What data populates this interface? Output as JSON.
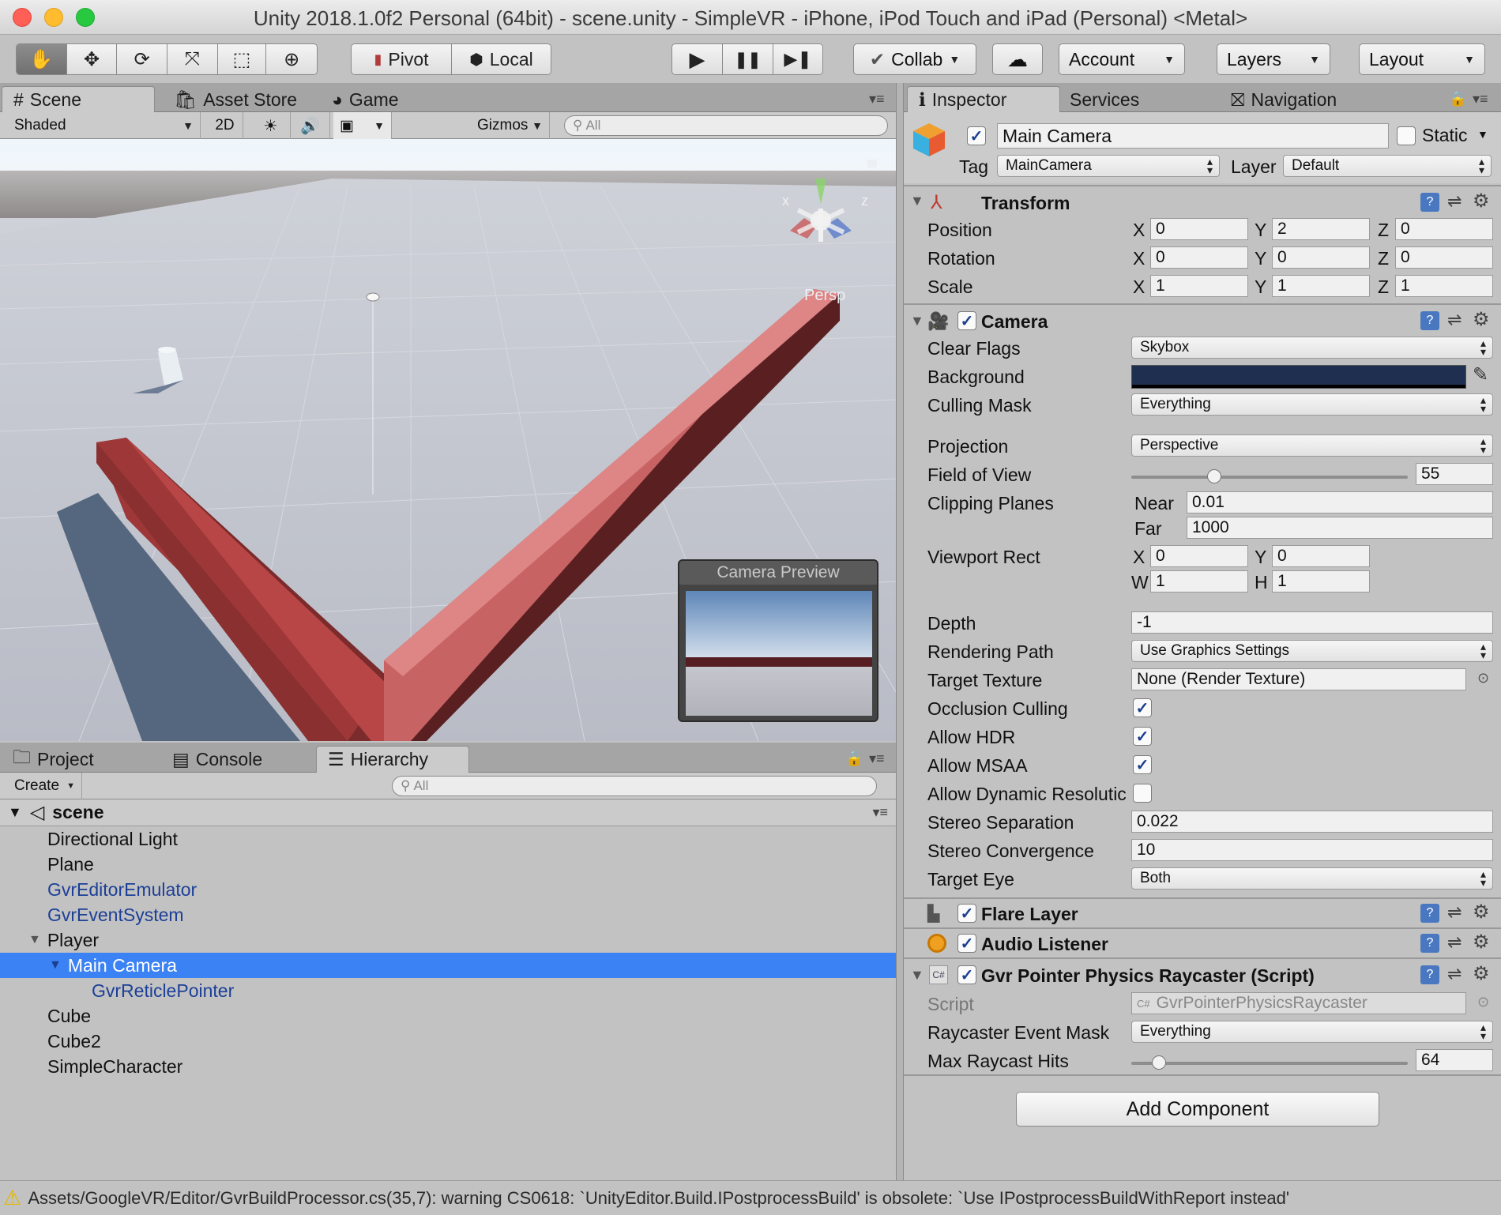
{
  "window": {
    "title": "Unity 2018.1.0f2 Personal (64bit) - scene.unity - SimpleVR - iPhone, iPod Touch and iPad (Personal) <Metal>"
  },
  "colors": {
    "close": "#fe5f57",
    "minimize": "#febc2e",
    "maximize": "#28c840",
    "selection": "#3b82f4",
    "prefab_blue": "#1c3f97",
    "background_color": "#1f2f4f",
    "bar_red": "#c24a4a"
  },
  "toolbar": {
    "tools": [
      "hand-icon",
      "move-icon",
      "rotate-icon",
      "scale-icon",
      "rect-icon",
      "transform-icon"
    ],
    "pivot": "Pivot",
    "local": "Local",
    "play": "▶",
    "pause": "❚❚",
    "step": "▶❚",
    "collab": "Collab",
    "account": "Account",
    "layers": "Layers",
    "layout": "Layout"
  },
  "scene_tabs": {
    "scene": "Scene",
    "asset_store": "Asset Store",
    "game": "Game"
  },
  "scene_toolbar": {
    "shading": "Shaded",
    "two_d": "2D",
    "gizmos": "Gizmos",
    "search_placeholder": "All"
  },
  "scene_view": {
    "persp": "Persp",
    "gizmo_x": "x",
    "gizmo_z": "z",
    "preview_title": "Camera Preview"
  },
  "bottom_tabs": {
    "project": "Project",
    "console": "Console",
    "hierarchy": "Hierarchy"
  },
  "hierarchy": {
    "create": "Create",
    "search_placeholder": "All",
    "scene": "scene",
    "items": [
      {
        "label": "Directional Light"
      },
      {
        "label": "Plane"
      },
      {
        "label": "GvrEditorEmulator"
      },
      {
        "label": "GvrEventSystem"
      },
      {
        "label": "Player"
      },
      {
        "label": "Main Camera"
      },
      {
        "label": "GvrReticlePointer"
      },
      {
        "label": "Cube"
      },
      {
        "label": "Cube2"
      },
      {
        "label": "SimpleCharacter"
      }
    ]
  },
  "inspector_tabs": {
    "inspector": "Inspector",
    "services": "Services",
    "navigation": "Navigation"
  },
  "inspector": {
    "object_name": "Main Camera",
    "static_label": "Static",
    "tag_label": "Tag",
    "tag_value": "MainCamera",
    "layer_label": "Layer",
    "layer_value": "Default",
    "transform": {
      "title": "Transform",
      "position": {
        "label": "Position",
        "x": "0",
        "y": "2",
        "z": "0"
      },
      "rotation": {
        "label": "Rotation",
        "x": "0",
        "y": "0",
        "z": "0"
      },
      "scale": {
        "label": "Scale",
        "x": "1",
        "y": "1",
        "z": "1"
      },
      "axis_x": "X",
      "axis_y": "Y",
      "axis_z": "Z"
    },
    "camera": {
      "title": "Camera",
      "clear_flags": {
        "label": "Clear Flags",
        "value": "Skybox"
      },
      "background": {
        "label": "Background"
      },
      "culling_mask": {
        "label": "Culling Mask",
        "value": "Everything"
      },
      "projection": {
        "label": "Projection",
        "value": "Perspective"
      },
      "fov": {
        "label": "Field of View",
        "value": "55",
        "fraction": 0.3
      },
      "clipping": {
        "label": "Clipping Planes",
        "near_label": "Near",
        "near": "0.01",
        "far_label": "Far",
        "far": "1000"
      },
      "viewport": {
        "label": "Viewport Rect",
        "x": "0",
        "y": "0",
        "w": "1",
        "h": "1",
        "x_label": "X",
        "y_label": "Y",
        "w_label": "W",
        "h_label": "H"
      },
      "depth": {
        "label": "Depth",
        "value": "-1"
      },
      "rendering_path": {
        "label": "Rendering Path",
        "value": "Use Graphics Settings"
      },
      "target_texture": {
        "label": "Target Texture",
        "value": "None (Render Texture)"
      },
      "occlusion": {
        "label": "Occlusion Culling",
        "checked": true
      },
      "hdr": {
        "label": "Allow HDR",
        "checked": true
      },
      "msaa": {
        "label": "Allow MSAA",
        "checked": true
      },
      "dynamic_res": {
        "label": "Allow Dynamic Resolutic",
        "checked": false
      },
      "stereo_sep": {
        "label": "Stereo Separation",
        "value": "0.022"
      },
      "stereo_conv": {
        "label": "Stereo Convergence",
        "value": "10"
      },
      "target_eye": {
        "label": "Target Eye",
        "value": "Both"
      }
    },
    "flare_layer": {
      "title": "Flare Layer"
    },
    "audio_listener": {
      "title": "Audio Listener"
    },
    "raycaster": {
      "title": "Gvr Pointer Physics Raycaster (Script)",
      "script": {
        "label": "Script",
        "value": "GvrPointerPhysicsRaycaster"
      },
      "event_mask": {
        "label": "Raycaster Event Mask",
        "value": "Everything"
      },
      "max_hits": {
        "label": "Max Raycast Hits",
        "value": "64",
        "fraction": 0.1
      }
    },
    "add_component": "Add Component"
  },
  "status": {
    "message": "Assets/GoogleVR/Editor/GvrBuildProcessor.cs(35,7): warning CS0618: `UnityEditor.Build.IPostprocessBuild' is obsolete: `Use IPostprocessBuildWithReport instead'"
  }
}
